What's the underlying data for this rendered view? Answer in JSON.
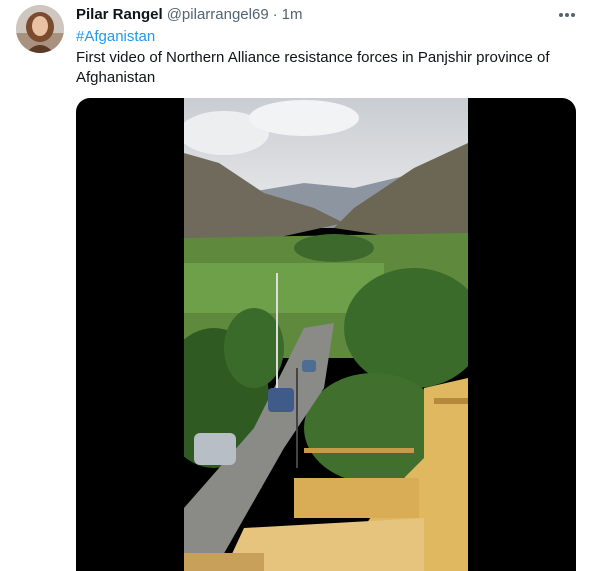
{
  "tweet": {
    "author_name": "Pilar Rangel",
    "handle": "@pilarrangel69",
    "separator": "·",
    "time": "1m",
    "hashtag": "#Afganistan",
    "text": "First video of Northern Alliance resistance forces in Panjshir province of Afghanistan"
  },
  "icons": {
    "more": "more-horizontal-icon",
    "avatar": "profile-avatar"
  },
  "colors": {
    "link": "#1d9bf0",
    "secondary_text": "#536471",
    "primary_text": "#0f1419",
    "media_background": "#000000"
  }
}
